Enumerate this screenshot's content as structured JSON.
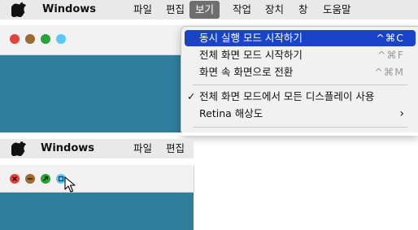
{
  "top_panel": {
    "app_name": "Windows",
    "menus": [
      "파일",
      "편집",
      "보기",
      "작업",
      "장치",
      "창",
      "도움말"
    ],
    "active_menu": "보기"
  },
  "dropdown": {
    "items": [
      {
        "label": "동시 실행 모드 시작하기",
        "shortcut": "^⌘C"
      },
      {
        "label": "전체 화면 모드 시작하기",
        "shortcut": "^⌘F"
      },
      {
        "label": "화면 속 화면으로 전환",
        "shortcut": "^⌘M"
      },
      {
        "label": "전체 화면 모드에서 모든 디스플레이 사용",
        "check": "✓"
      },
      {
        "label": "Retina 해상도",
        "arrow": "›"
      }
    ]
  },
  "bottom_panel": {
    "app_name": "Windows",
    "menus": [
      "파일",
      "편집"
    ]
  },
  "colors": {
    "teal": "#2f7e9b",
    "highlight": "#1a44c7",
    "close": "#e0443e",
    "minimize": "#9a6a2e",
    "zoom": "#2aa43a",
    "extra": "#5ac8fa"
  }
}
